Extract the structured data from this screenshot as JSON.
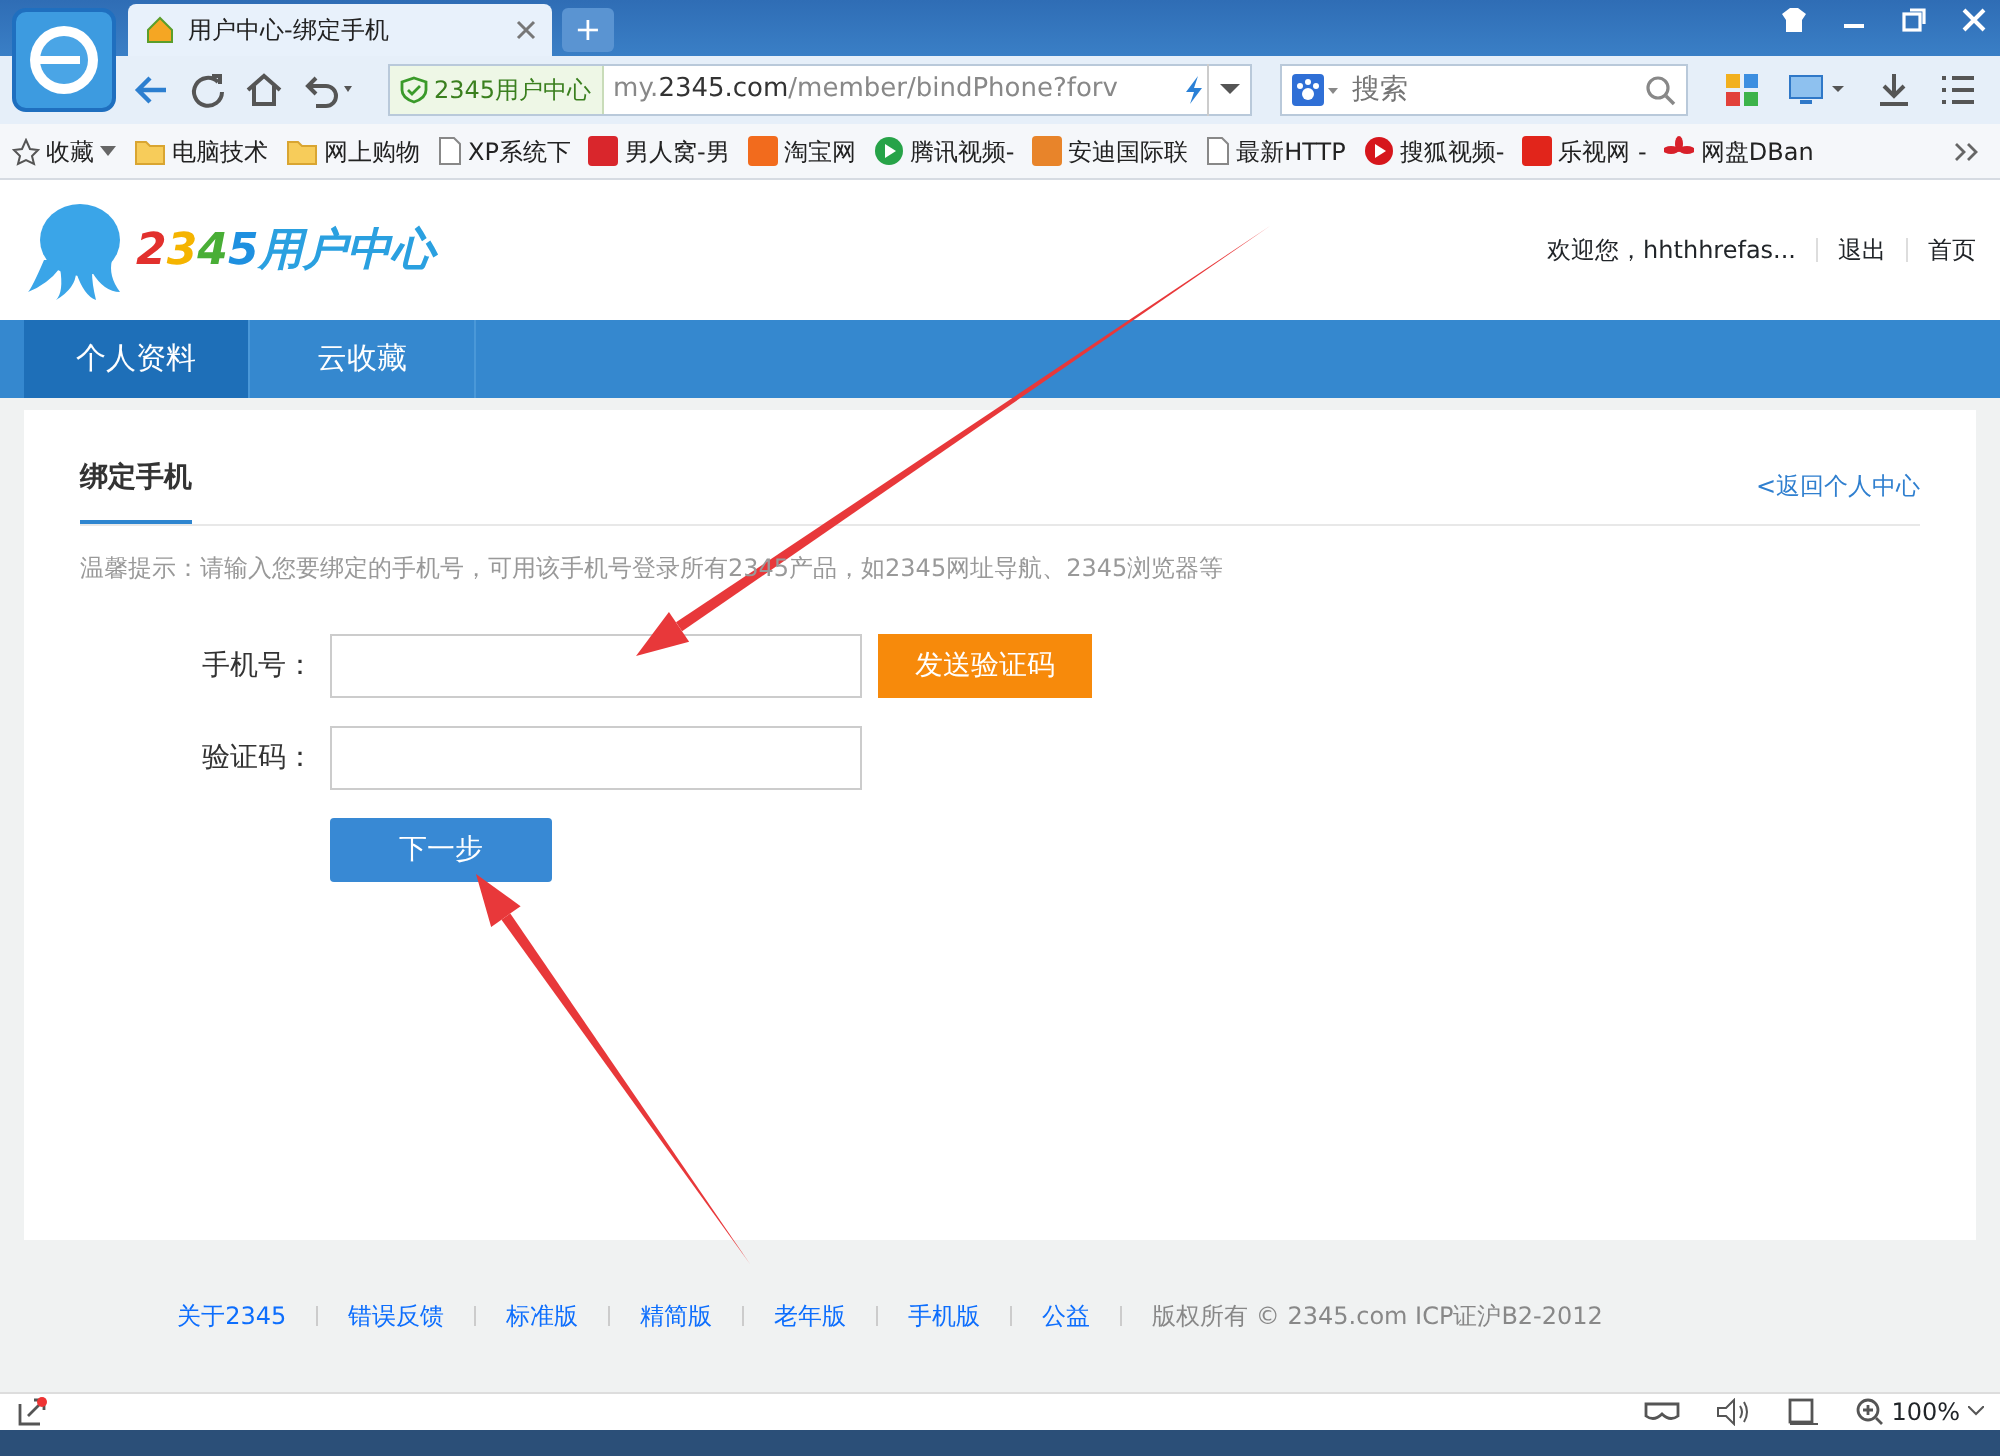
{
  "browser": {
    "tab_title": "用户中心-绑定手机",
    "new_tab": "+",
    "address_badge": "2345用户中心",
    "url": "my.**2345.com**/member/bindPhone?forv",
    "search_placeholder": "搜索",
    "bookmarks_label": "收藏",
    "bookmarks": [
      {
        "label": "电脑技术",
        "kind": "folder"
      },
      {
        "label": "网上购物",
        "kind": "folder"
      },
      {
        "label": "XP系统下",
        "kind": "page"
      },
      {
        "label": "男人窝-男",
        "kind": "square",
        "color": "#d9262c"
      },
      {
        "label": "淘宝网",
        "kind": "square",
        "color": "#f26b1d"
      },
      {
        "label": "腾讯视频-",
        "kind": "play",
        "color": "#27a348"
      },
      {
        "label": "安迪国际联",
        "kind": "square",
        "color": "#e8842a"
      },
      {
        "label": "最新HTTP",
        "kind": "page"
      },
      {
        "label": "搜狐视频-",
        "kind": "play",
        "color": "#d6161c"
      },
      {
        "label": "乐视网 -",
        "kind": "square",
        "color": "#e1251b"
      },
      {
        "label": "网盘DBan",
        "kind": "flower",
        "color": "#d8202a"
      }
    ],
    "zoom": "100%"
  },
  "header": {
    "logo": "2345用户中心",
    "welcome": "欢迎您，hhthhrefas...",
    "links": [
      "退出",
      "首页"
    ]
  },
  "nav": [
    {
      "label": "个人资料",
      "selected": true
    },
    {
      "label": "云收藏",
      "selected": false
    }
  ],
  "panel": {
    "title": "绑定手机",
    "back_link": "<返回个人中心",
    "hint": "温馨提示：请输入您要绑定的手机号，可用该手机号登录所有2345产品，如2345网址导航、2345浏览器等",
    "fields": [
      {
        "label": "手机号：",
        "action": "发送验证码"
      },
      {
        "label": "验证码："
      }
    ],
    "submit": "下一步"
  },
  "footer": {
    "links": [
      "关于2345",
      "错误反馈",
      "标准版",
      "精简版",
      "老年版",
      "手机版",
      "公益"
    ],
    "copyright": "版权所有 © 2345.com ICP证沪B2-2012"
  }
}
